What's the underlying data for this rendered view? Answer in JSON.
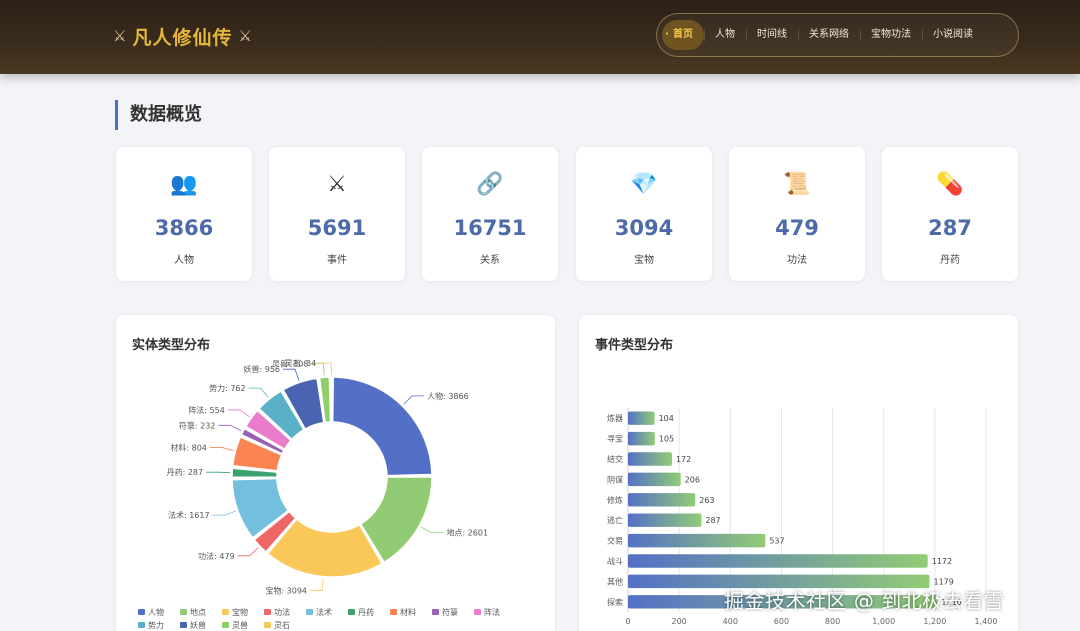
{
  "header": {
    "title": "凡人修仙传",
    "nav": [
      "首页",
      "人物",
      "时间线",
      "关系网络",
      "宝物功法",
      "小说阅读"
    ],
    "active_index": 0
  },
  "overview": {
    "title": "数据概览",
    "stats": [
      {
        "icon": "people-icon",
        "glyph": "👥",
        "value": "3866",
        "label": "人物"
      },
      {
        "icon": "crossed-swords-icon",
        "glyph": "⚔",
        "value": "5691",
        "label": "事件"
      },
      {
        "icon": "link-icon",
        "glyph": "🔗",
        "value": "16751",
        "label": "关系"
      },
      {
        "icon": "gem-icon",
        "glyph": "💎",
        "value": "3094",
        "label": "宝物"
      },
      {
        "icon": "scroll-icon",
        "glyph": "📜",
        "value": "479",
        "label": "功法"
      },
      {
        "icon": "pill-icon",
        "glyph": "💊",
        "value": "287",
        "label": "丹药"
      }
    ]
  },
  "chart_data": [
    {
      "type": "pie",
      "title": "实体类型分布",
      "legend_position": "bottom",
      "categories": [
        "人物",
        "地点",
        "宝物",
        "功法",
        "法术",
        "丹药",
        "材料",
        "符箓",
        "阵法",
        "势力",
        "妖兽",
        "灵兽",
        "灵石"
      ],
      "values": [
        3866,
        2601,
        3094,
        479,
        1617,
        287,
        804,
        232,
        554,
        762,
        956,
        308,
        34
      ],
      "colors": [
        "#5470c6",
        "#91cc75",
        "#fac858",
        "#ee6666",
        "#73c0de",
        "#3ba272",
        "#fc8452",
        "#9a60b4",
        "#ea7ccc",
        "#5ab1c7",
        "#4a64b2",
        "#8fcf6a",
        "#f7c85a"
      ]
    },
    {
      "type": "bar",
      "title": "事件类型分布",
      "orientation": "horizontal",
      "categories": [
        "炼器",
        "寻宝",
        "结交",
        "阴谋",
        "修炼",
        "逃亡",
        "交易",
        "战斗",
        "其他",
        "探索"
      ],
      "values": [
        104,
        105,
        172,
        206,
        263,
        287,
        537,
        1172,
        1179,
        1210
      ],
      "xlim": [
        0,
        1400
      ],
      "xticks": [
        "0",
        "200",
        "400",
        "600",
        "800",
        "1,000",
        "1,200",
        "1,400"
      ],
      "grid": true,
      "bar_gradient": [
        "#5470c6",
        "#91cc75"
      ]
    }
  ],
  "watermark": "掘金技术社区 @ 到北极去看雪"
}
